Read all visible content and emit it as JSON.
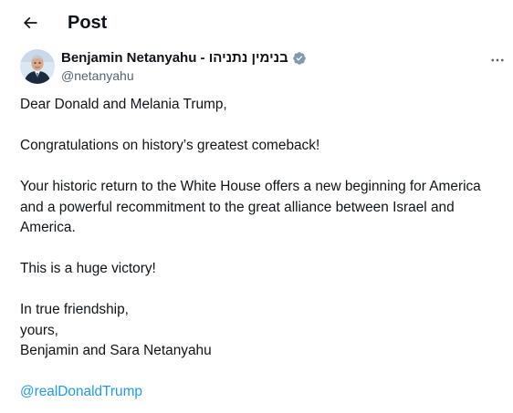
{
  "header": {
    "title": "Post",
    "back_icon": "arrow-left-icon"
  },
  "author": {
    "display_name": "Benjamin Netanyahu - בנימין נתניהו",
    "handle": "@netanyahu",
    "verified_icon": "verified-badge-icon",
    "verified_color": "#829aab",
    "more_icon": "more-horizontal-icon"
  },
  "post": {
    "greeting": "Dear Donald and Melania Trump,",
    "line_congrats": "Congratulations on history’s greatest comeback!",
    "paragraph_return": "Your historic return to the White House offers a new beginning for America and a powerful recommitment to the great alliance between Israel and America.",
    "line_victory": "This is a huge victory!",
    "closing_1": "In true friendship,",
    "closing_2": "yours,",
    "signature": "Benjamin and Sara Netanyahu",
    "mention": "@realDonaldTrump"
  },
  "colors": {
    "text": "#0f1419",
    "secondary": "#536471",
    "link": "#1d9bf0"
  }
}
